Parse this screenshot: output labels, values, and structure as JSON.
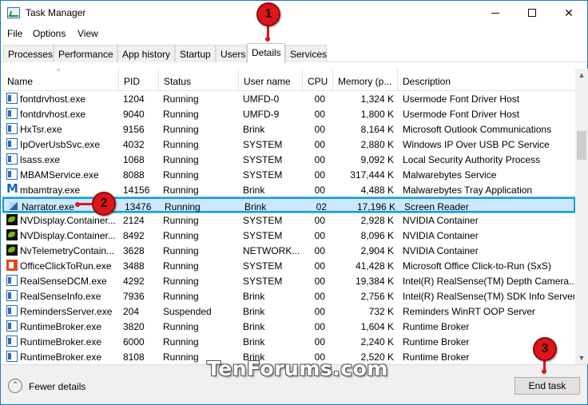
{
  "window": {
    "title": "Task Manager"
  },
  "menu": [
    "File",
    "Options",
    "View"
  ],
  "tabs": [
    {
      "label": "Processes"
    },
    {
      "label": "Performance"
    },
    {
      "label": "App history"
    },
    {
      "label": "Startup"
    },
    {
      "label": "Users"
    },
    {
      "label": "Details",
      "active": true
    },
    {
      "label": "Services"
    }
  ],
  "columns": [
    "Name",
    "PID",
    "Status",
    "User name",
    "CPU",
    "Memory (p...",
    "Description"
  ],
  "rows": [
    {
      "icon": "app-icon",
      "name": "fontdrvhost.exe",
      "pid": "1204",
      "status": "Running",
      "user": "UMFD-0",
      "cpu": "00",
      "mem": "1,324 K",
      "desc": "Usermode Font Driver Host"
    },
    {
      "icon": "app-icon",
      "name": "fontdrvhost.exe",
      "pid": "9040",
      "status": "Running",
      "user": "UMFD-9",
      "cpu": "00",
      "mem": "1,800 K",
      "desc": "Usermode Font Driver Host"
    },
    {
      "icon": "app-icon",
      "name": "HxTsr.exe",
      "pid": "9156",
      "status": "Running",
      "user": "Brink",
      "cpu": "00",
      "mem": "8,164 K",
      "desc": "Microsoft Outlook Communications"
    },
    {
      "icon": "app-icon",
      "name": "IpOverUsbSvc.exe",
      "pid": "4032",
      "status": "Running",
      "user": "SYSTEM",
      "cpu": "00",
      "mem": "2,880 K",
      "desc": "Windows IP Over USB PC Service"
    },
    {
      "icon": "app-icon",
      "name": "lsass.exe",
      "pid": "1068",
      "status": "Running",
      "user": "SYSTEM",
      "cpu": "00",
      "mem": "9,092 K",
      "desc": "Local Security Authority Process"
    },
    {
      "icon": "app-icon",
      "name": "MBAMService.exe",
      "pid": "8088",
      "status": "Running",
      "user": "SYSTEM",
      "cpu": "00",
      "mem": "317,444 K",
      "desc": "Malwarebytes Service"
    },
    {
      "icon": "malwarebytes-icon",
      "name": "mbamtray.exe",
      "pid": "14156",
      "status": "Running",
      "user": "Brink",
      "cpu": "00",
      "mem": "4,488 K",
      "desc": "Malwarebytes Tray Application"
    },
    {
      "icon": "narrator-icon",
      "name": "Narrator.exe",
      "pid": "13476",
      "status": "Running",
      "user": "Brink",
      "cpu": "02",
      "mem": "17,196 K",
      "desc": "Screen Reader",
      "selected": true
    },
    {
      "icon": "nvidia-icon",
      "name": "NVDisplay.Container...",
      "pid": "2124",
      "status": "Running",
      "user": "SYSTEM",
      "cpu": "00",
      "mem": "2,928 K",
      "desc": "NVIDIA Container"
    },
    {
      "icon": "nvidia-icon",
      "name": "NVDisplay.Container...",
      "pid": "8492",
      "status": "Running",
      "user": "SYSTEM",
      "cpu": "00",
      "mem": "8,096 K",
      "desc": "NVIDIA Container"
    },
    {
      "icon": "nvidia-icon",
      "name": "NvTelemetryContain...",
      "pid": "3628",
      "status": "Running",
      "user": "NETWORK...",
      "cpu": "00",
      "mem": "2,904 K",
      "desc": "NVIDIA Container"
    },
    {
      "icon": "office-icon",
      "name": "OfficeClickToRun.exe",
      "pid": "3488",
      "status": "Running",
      "user": "SYSTEM",
      "cpu": "00",
      "mem": "41,428 K",
      "desc": "Microsoft Office Click-to-Run (SxS)"
    },
    {
      "icon": "app-icon",
      "name": "RealSenseDCM.exe",
      "pid": "4292",
      "status": "Running",
      "user": "SYSTEM",
      "cpu": "00",
      "mem": "19,384 K",
      "desc": "Intel(R) RealSense(TM) Depth Camera..."
    },
    {
      "icon": "app-icon",
      "name": "RealSenseInfo.exe",
      "pid": "7936",
      "status": "Running",
      "user": "Brink",
      "cpu": "00",
      "mem": "2,756 K",
      "desc": "Intel(R) RealSense(TM) SDK Info Server"
    },
    {
      "icon": "app-icon",
      "name": "RemindersServer.exe",
      "pid": "204",
      "status": "Suspended",
      "user": "Brink",
      "cpu": "00",
      "mem": "732 K",
      "desc": "Reminders WinRT OOP Server"
    },
    {
      "icon": "app-icon",
      "name": "RuntimeBroker.exe",
      "pid": "3820",
      "status": "Running",
      "user": "Brink",
      "cpu": "00",
      "mem": "1,604 K",
      "desc": "Runtime Broker"
    },
    {
      "icon": "app-icon",
      "name": "RuntimeBroker.exe",
      "pid": "6000",
      "status": "Running",
      "user": "Brink",
      "cpu": "00",
      "mem": "2,240 K",
      "desc": "Runtime Broker"
    },
    {
      "icon": "app-icon",
      "name": "RuntimeBroker.exe",
      "pid": "8108",
      "status": "Running",
      "user": "Brink",
      "cpu": "00",
      "mem": "2,520 K",
      "desc": "Runtime Broker"
    }
  ],
  "footer": {
    "fewer_details": "Fewer details",
    "end_task": "End task"
  },
  "watermark": "TenForums.com",
  "callouts": [
    "1",
    "2",
    "3"
  ],
  "colors": {
    "selection": "#cce8ff",
    "selection_border": "#1a9bd7",
    "callout": "#e0141b"
  }
}
